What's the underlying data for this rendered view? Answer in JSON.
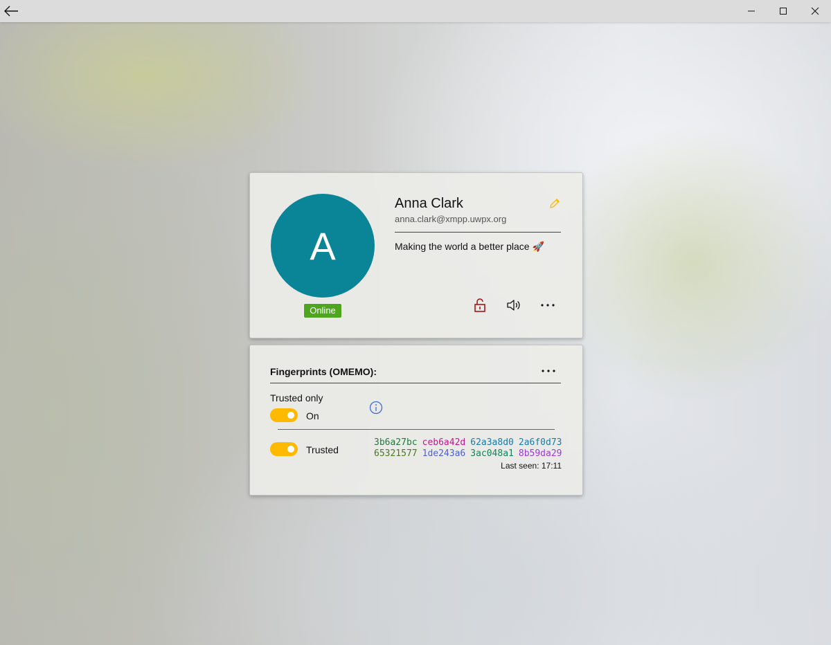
{
  "window": {
    "back_icon": "back-arrow-icon",
    "minimize_icon": "minimize-icon",
    "maximize_icon": "maximize-icon",
    "close_icon": "close-icon"
  },
  "profile": {
    "avatar_letter": "A",
    "avatar_color": "#0a8497",
    "status": "Online",
    "status_color": "#4ea51e",
    "name": "Anna Clark",
    "jid": "anna.clark@xmpp.uwpx.org",
    "status_message": "Making the world a better place 🚀",
    "edit_icon": "pencil-icon",
    "actions": [
      "unlocked-lock-icon",
      "speaker-icon",
      "more-icon"
    ]
  },
  "fingerprints": {
    "title": "Fingerprints (OMEMO):",
    "trusted_only_label": "Trusted only",
    "trusted_only_state": "On",
    "toggle_color": "#ffb900",
    "info_icon": "info-icon",
    "device": {
      "trust_label": "Trusted",
      "fingerprint_rows": [
        [
          "3b6a27bc",
          "ceb6a42d",
          "62a3a8d0",
          "2a6f0d73"
        ],
        [
          "65321577",
          "1de243a6",
          "3ac048a1",
          "8b59da29"
        ]
      ],
      "fingerprint_colors": [
        [
          "#1e7a3c",
          "#c5168c",
          "#1a7aa8",
          "#1a7aa8"
        ],
        [
          "#4a7a1e",
          "#4f5fd6",
          "#18825a",
          "#9b3ad6"
        ]
      ],
      "last_seen": "Last seen: 17:11"
    }
  }
}
